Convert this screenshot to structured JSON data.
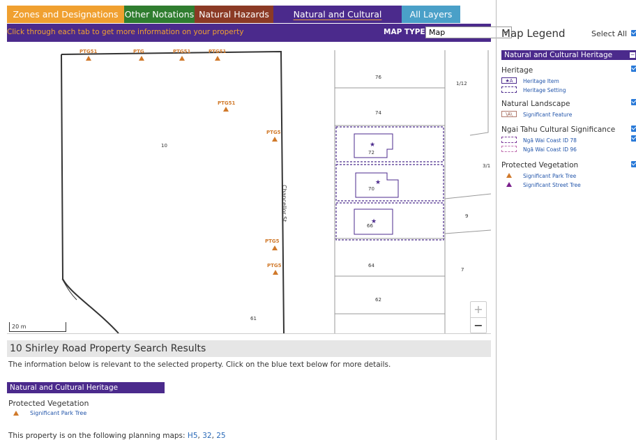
{
  "tabs": [
    {
      "label": "Zones and Designations",
      "bg": "#f0a030",
      "color": "#ffffff"
    },
    {
      "label": "Other Notations",
      "bg": "#2f7d2f",
      "color": "#ffffff"
    },
    {
      "label": "Natural Hazards",
      "bg": "#8b3a25",
      "color": "#ffffff"
    },
    {
      "label": "Natural and Cultural Heritage",
      "bg": "#4b2a8c",
      "color": "#ffffff"
    },
    {
      "label": "All Layers",
      "bg": "#4aa0c8",
      "color": "#ffffff"
    }
  ],
  "toolbar": {
    "hint": "Click through each tab to get more information on your property",
    "map_type_label": "MAP TYPE",
    "map_type_value": "Map"
  },
  "map": {
    "ptg_labels": [
      "PTG51",
      "PTG",
      "PTG51",
      "PTG51",
      "PTG51",
      "PTG5",
      "PTG5",
      "PTG5"
    ],
    "street_label": "Chancellor St",
    "parcel_numbers": [
      "10",
      "61",
      "76",
      "1/12",
      "74",
      "72",
      "70",
      "66",
      "3/1",
      "9",
      "64",
      "7",
      "62"
    ],
    "scale_label": "20 m",
    "zoom_in": "+",
    "zoom_out": "−"
  },
  "results": {
    "heading": "10 Shirley Road Property Search Results",
    "description": "The information below is relevant to the selected property. Click on the blue text below for more details.",
    "section_title": "Natural and Cultural Heritage",
    "subsection": "Protected Vegetation",
    "item": "Significant Park Tree",
    "maps_prefix": "This property is on the following planning maps: ",
    "maps": [
      "H5",
      "32",
      "25"
    ]
  },
  "legend": {
    "title": "Map Legend",
    "select_all": "Select All",
    "section": "Natural and Cultural Heritage",
    "groups": [
      {
        "heading": "Heritage",
        "items": [
          "Heritage Item",
          "Heritage Setting"
        ]
      },
      {
        "heading": "Natural Landscape",
        "items": [
          "Significant Feature"
        ]
      },
      {
        "heading": "Ngai Tahu Cultural Significance",
        "items": [
          "Ngā Wai Coast ID 78",
          "Ngā Wai Coast ID 96"
        ]
      },
      {
        "heading": "Protected Vegetation",
        "items": [
          "Significant Park Tree",
          "Significant Street Tree"
        ]
      }
    ],
    "swatch_heritage_item": "★A",
    "swatch_significant_feature": "\\A\\"
  },
  "colors": {
    "purple": "#4b2a8c",
    "orange_ptg": "#d0792a",
    "street_tree": "#7a1f8c",
    "link": "#2a6ab8"
  }
}
